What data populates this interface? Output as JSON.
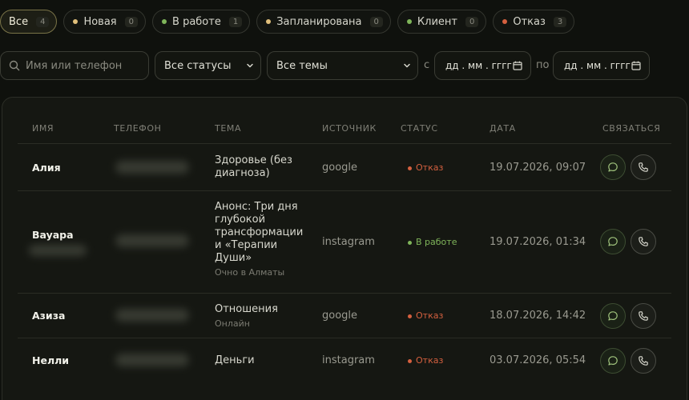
{
  "colors": {
    "new": "#e0bf7b",
    "in_progress": "#7fb55a",
    "planned": "#e0bf7b",
    "client": "#7fb55a",
    "refused": "#d5603f",
    "chat_icon": "#9fc27c",
    "call_icon": "#d6d6cc"
  },
  "tabs": [
    {
      "label": "Все",
      "count": "4"
    },
    {
      "label": "Новая",
      "count": "0"
    },
    {
      "label": "В работе",
      "count": "1"
    },
    {
      "label": "Запланирована",
      "count": "0"
    },
    {
      "label": "Клиент",
      "count": "0"
    },
    {
      "label": "Отказ",
      "count": "3"
    }
  ],
  "filters": {
    "search_placeholder": "Имя или телефон",
    "status_select": "Все статусы",
    "topic_select": "Все темы",
    "from_label": "с",
    "to_label": "по",
    "date_from": "дд . мм . гггг",
    "date_to": "дд . мм . гггг"
  },
  "table": {
    "headers": {
      "name": "Имя",
      "phone": "Телефон",
      "topic": "Тема",
      "source": "Источник",
      "status": "Статус",
      "date": "Дата",
      "contact": "Связаться"
    },
    "rows": [
      {
        "name": "Алия",
        "topic": "Здоровье (без диагноза)",
        "topic_sub": "",
        "source": "google",
        "status": "Отказ",
        "date": "19.07.2026, 09:07"
      },
      {
        "name": "Bayapa",
        "topic": "Анонс: Три дня глубокой трансформации и «Терапии Души»",
        "topic_sub": "Очно в Алматы",
        "source": "instagram",
        "status": "В работе",
        "date": "19.07.2026, 01:34"
      },
      {
        "name": "Азиза",
        "topic": "Отношения",
        "topic_sub": "Онлайн",
        "source": "google",
        "status": "Отказ",
        "date": "18.07.2026, 14:42"
      },
      {
        "name": "Нелли",
        "topic": "Деньги",
        "topic_sub": "",
        "source": "instagram",
        "status": "Отказ",
        "date": "03.07.2026, 05:54"
      }
    ]
  }
}
